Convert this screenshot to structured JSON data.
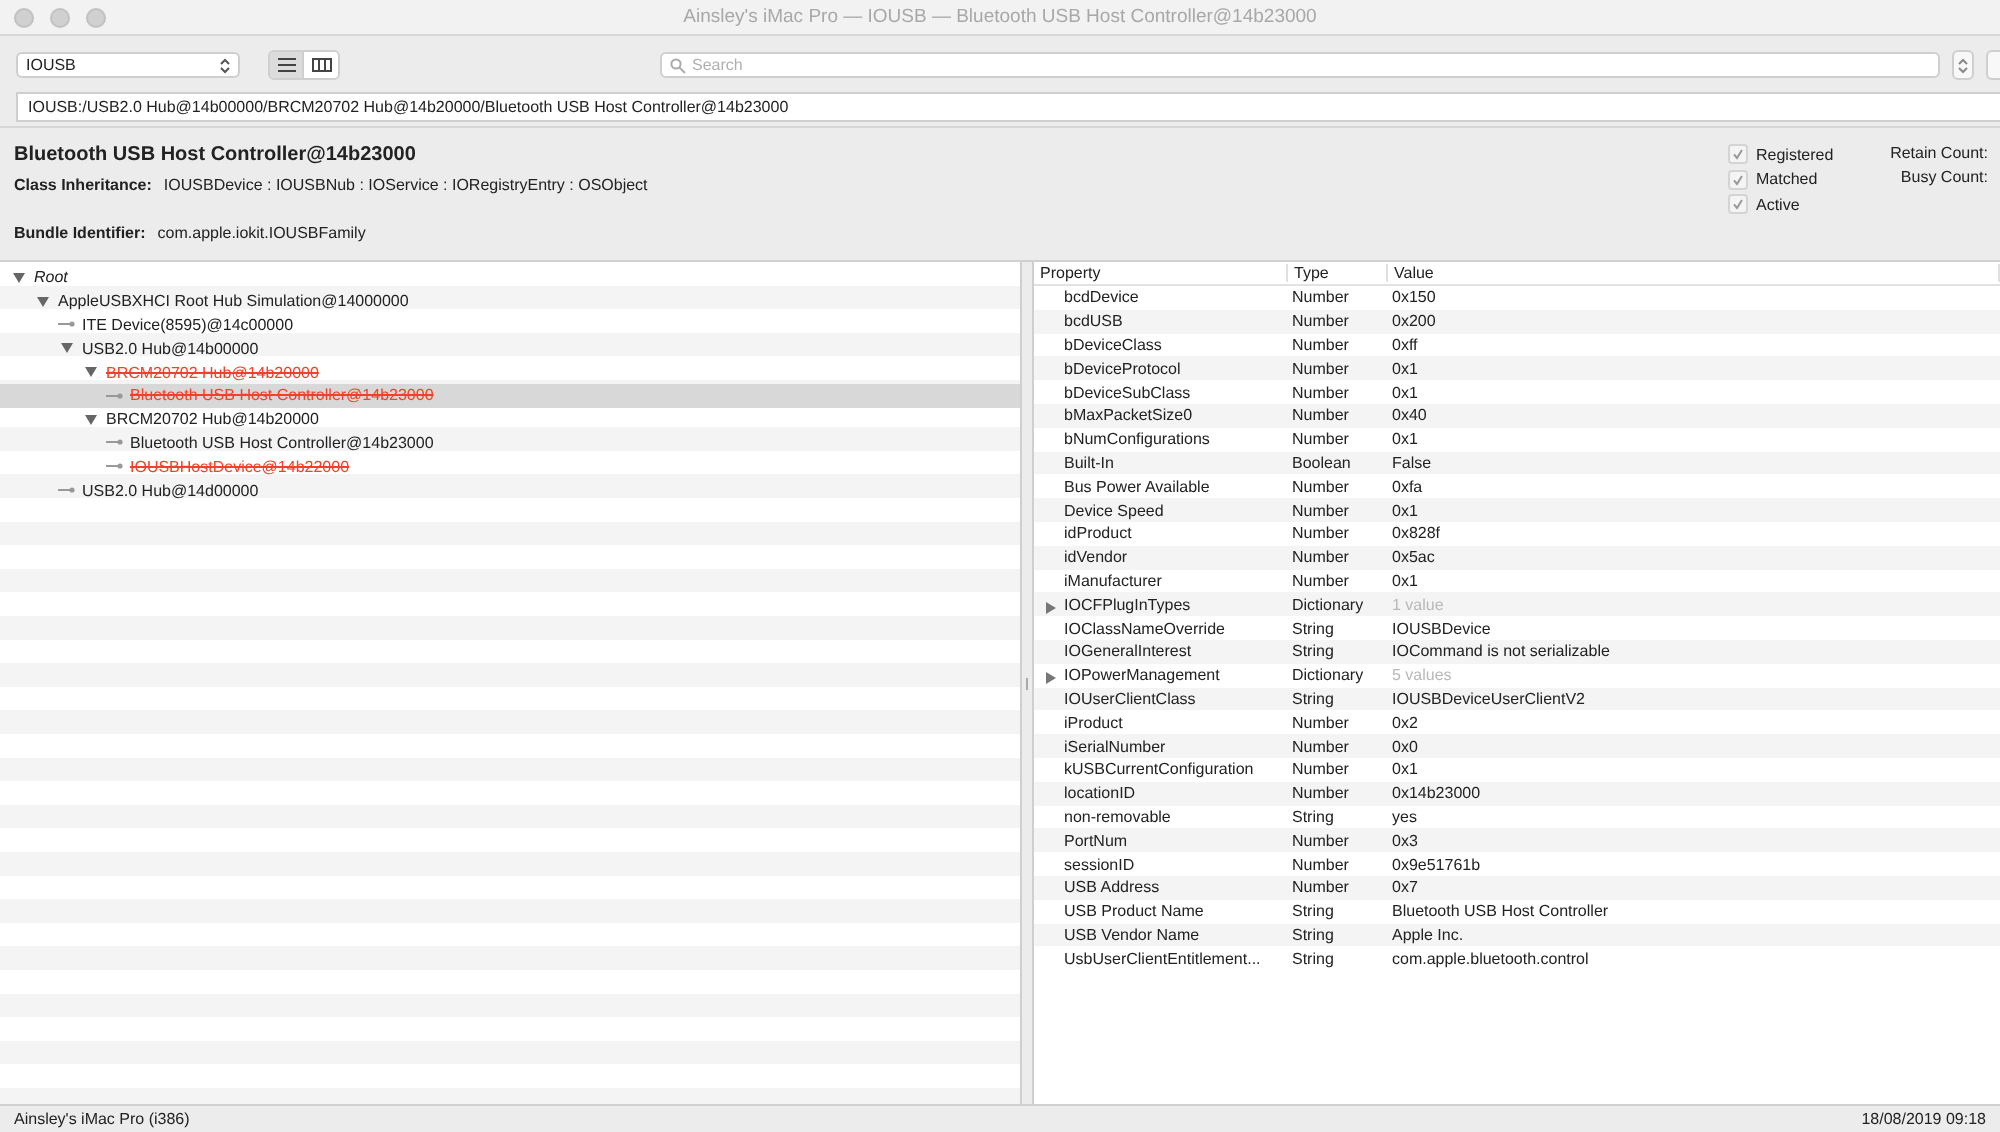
{
  "window": {
    "title": "Ainsley's iMac Pro — IOUSB — Bluetooth USB Host Controller@14b23000"
  },
  "toolbar": {
    "plane": "IOUSB",
    "views": [
      {
        "kind": "list",
        "selected": true
      },
      {
        "kind": "columns",
        "selected": false
      }
    ],
    "search": {
      "placeholder": "Search"
    }
  },
  "path": "IOUSB:/USB2.0 Hub@14b00000/BRCM20702 Hub@14b20000/Bluetooth USB Host Controller@14b23000",
  "info": {
    "name": "Bluetooth USB Host Controller@14b23000",
    "class_label": "Class Inheritance:",
    "class_value": "IOUSBDevice : IOUSBNub : IOService : IORegistryEntry : OSObject",
    "bundle_label": "Bundle Identifier:",
    "bundle_value": "com.apple.iokit.IOUSBFamily",
    "flags": [
      {
        "label": "Registered",
        "checked": true
      },
      {
        "label": "Matched",
        "checked": true
      },
      {
        "label": "Active",
        "checked": true
      }
    ],
    "counts": [
      {
        "label": "Retain Count:"
      },
      {
        "label": "Busy Count:"
      }
    ]
  },
  "tree": [
    {
      "label": "Root",
      "selected": false,
      "terminated": false,
      "expanded": true,
      "children": [
        {
          "label": "AppleUSBXHCI Root Hub Simulation@14000000",
          "selected": false,
          "terminated": false,
          "expanded": true,
          "children": [
            {
              "label": "ITE Device(8595)@14c00000",
              "selected": false,
              "terminated": false
            },
            {
              "label": "USB2.0 Hub@14b00000",
              "selected": false,
              "terminated": false,
              "expanded": true,
              "children": [
                {
                  "label": "BRCM20702 Hub@14b20000",
                  "selected": false,
                  "terminated": true,
                  "expanded": true,
                  "children": [
                    {
                      "label": "Bluetooth USB Host Controller@14b23000",
                      "selected": true,
                      "terminated": true
                    }
                  ]
                },
                {
                  "label": "BRCM20702 Hub@14b20000",
                  "selected": false,
                  "terminated": false,
                  "expanded": true,
                  "children": [
                    {
                      "label": "Bluetooth USB Host Controller@14b23000",
                      "selected": false,
                      "terminated": false
                    },
                    {
                      "label": "IOUSBHostDevice@14b22000",
                      "selected": false,
                      "terminated": true
                    }
                  ]
                }
              ]
            },
            {
              "label": "USB2.0 Hub@14d00000",
              "selected": false,
              "terminated": false
            }
          ]
        }
      ]
    }
  ],
  "properties": {
    "columns": [
      "Property",
      "Type",
      "Value"
    ],
    "rows": [
      {
        "kind": "value",
        "name": "bcdDevice",
        "type": "Number",
        "value": "0x150"
      },
      {
        "kind": "value",
        "name": "bcdUSB",
        "type": "Number",
        "value": "0x200"
      },
      {
        "kind": "value",
        "name": "bDeviceClass",
        "type": "Number",
        "value": "0xff"
      },
      {
        "kind": "value",
        "name": "bDeviceProtocol",
        "type": "Number",
        "value": "0x1"
      },
      {
        "kind": "value",
        "name": "bDeviceSubClass",
        "type": "Number",
        "value": "0x1"
      },
      {
        "kind": "value",
        "name": "bMaxPacketSize0",
        "type": "Number",
        "value": "0x40"
      },
      {
        "kind": "value",
        "name": "bNumConfigurations",
        "type": "Number",
        "value": "0x1"
      },
      {
        "kind": "value",
        "name": "Built-In",
        "type": "Boolean",
        "value": "False"
      },
      {
        "kind": "value",
        "name": "Bus Power Available",
        "type": "Number",
        "value": "0xfa"
      },
      {
        "kind": "value",
        "name": "Device Speed",
        "type": "Number",
        "value": "0x1"
      },
      {
        "kind": "value",
        "name": "idProduct",
        "type": "Number",
        "value": "0x828f"
      },
      {
        "kind": "value",
        "name": "idVendor",
        "type": "Number",
        "value": "0x5ac"
      },
      {
        "kind": "value",
        "name": "iManufacturer",
        "type": "Number",
        "value": "0x1"
      },
      {
        "kind": "dictionary",
        "name": "IOCFPlugInTypes",
        "type": "Dictionary",
        "value": "1 value",
        "expanded": false
      },
      {
        "kind": "value",
        "name": "IOClassNameOverride",
        "type": "String",
        "value": "IOUSBDevice"
      },
      {
        "kind": "value",
        "name": "IOGeneralInterest",
        "type": "String",
        "value": "IOCommand is not serializable"
      },
      {
        "kind": "dictionary",
        "name": "IOPowerManagement",
        "type": "Dictionary",
        "value": "5 values",
        "expanded": false
      },
      {
        "kind": "value",
        "name": "IOUserClientClass",
        "type": "String",
        "value": "IOUSBDeviceUserClientV2"
      },
      {
        "kind": "value",
        "name": "iProduct",
        "type": "Number",
        "value": "0x2"
      },
      {
        "kind": "value",
        "name": "iSerialNumber",
        "type": "Number",
        "value": "0x0"
      },
      {
        "kind": "value",
        "name": "kUSBCurrentConfiguration",
        "type": "Number",
        "value": "0x1"
      },
      {
        "kind": "value",
        "name": "locationID",
        "type": "Number",
        "value": "0x14b23000"
      },
      {
        "kind": "value",
        "name": "non-removable",
        "type": "String",
        "value": "yes"
      },
      {
        "kind": "value",
        "name": "PortNum",
        "type": "Number",
        "value": "0x3"
      },
      {
        "kind": "value",
        "name": "sessionID",
        "type": "Number",
        "value": "0x9e51761b"
      },
      {
        "kind": "value",
        "name": "USB Address",
        "type": "Number",
        "value": "0x7"
      },
      {
        "kind": "value",
        "name": "USB Product Name",
        "type": "String",
        "value": "Bluetooth USB Host Controller"
      },
      {
        "kind": "value",
        "name": "USB Vendor Name",
        "type": "String",
        "value": "Apple Inc."
      },
      {
        "kind": "value",
        "name": "UsbUserClientEntitlement...",
        "type": "String",
        "value": "com.apple.bluetooth.control"
      }
    ]
  },
  "status_bar": {
    "left": "Ainsley's iMac Pro (i386)",
    "right": "18/08/2019 09:18"
  }
}
